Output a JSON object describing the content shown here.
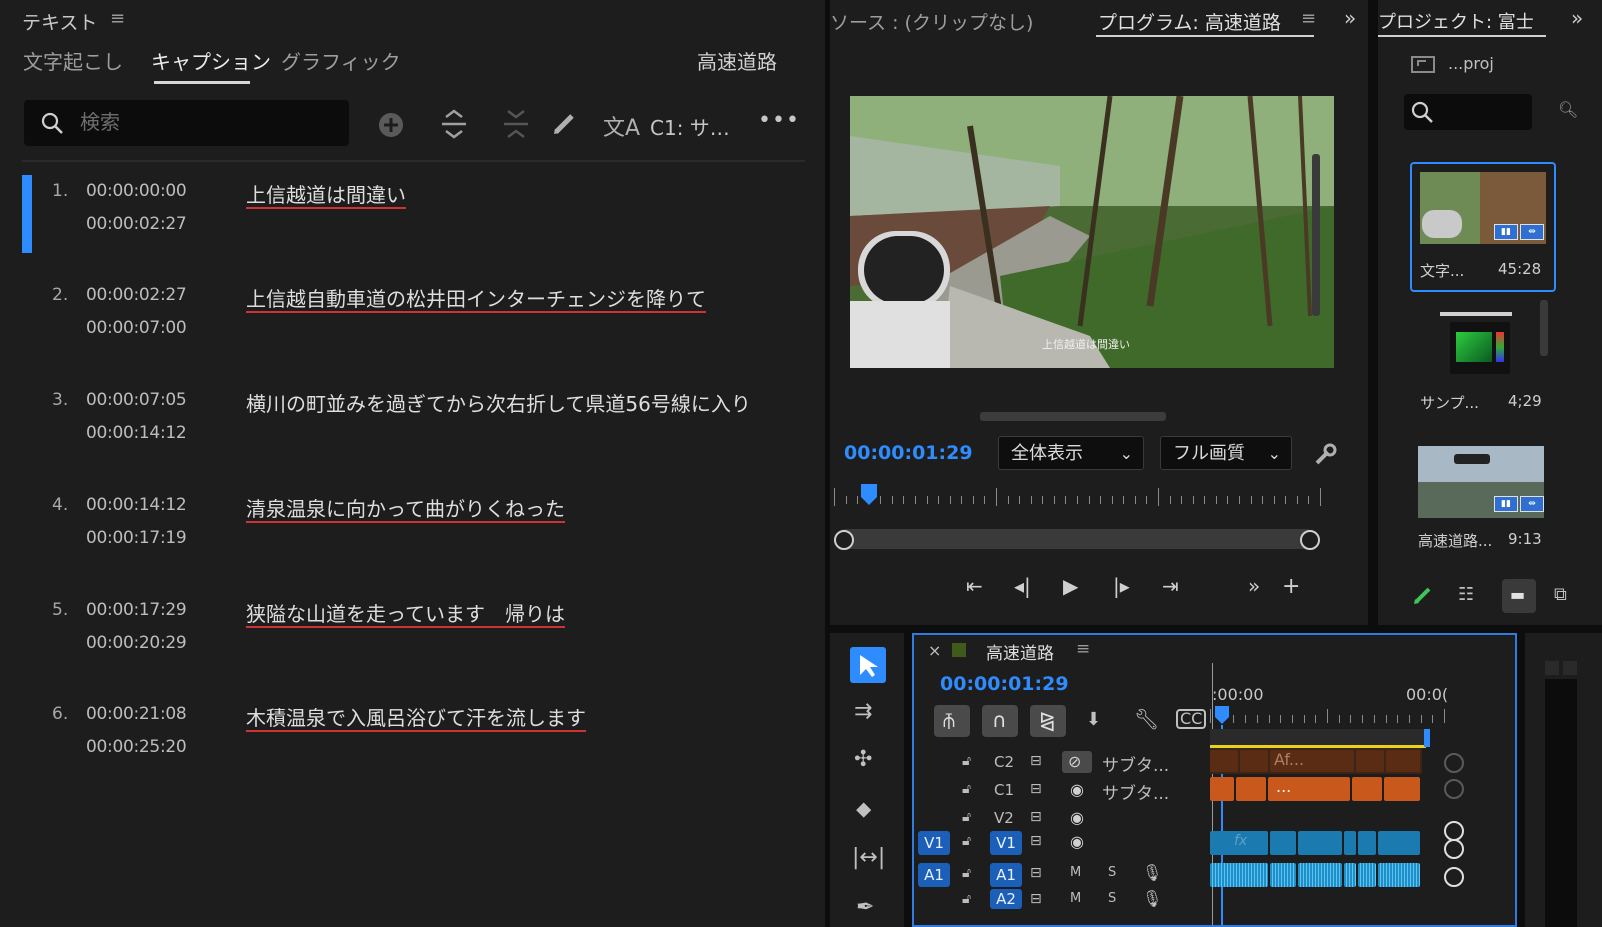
{
  "text_panel": {
    "title": "テキスト",
    "menu_icon": "hamburger-icon",
    "tabs": [
      {
        "label": "文字起こし",
        "active": false
      },
      {
        "label": "キャプション",
        "active": true
      },
      {
        "label": "グラフィック",
        "active": false
      }
    ],
    "sequence_name": "高速道路",
    "search_placeholder": "検索",
    "toolbar": {
      "icons": [
        "add-icon",
        "split-expand-icon",
        "merge-icon",
        "pencil-icon",
        "translate-icon",
        "more-icon"
      ],
      "track_label": "C1: サ…",
      "more_label": "•••"
    },
    "captions": [
      {
        "num": "1.",
        "start": "00:00:00:00",
        "end": "00:00:02:27",
        "text": "上信越道は間違い",
        "underlined": true
      },
      {
        "num": "2.",
        "start": "00:00:02:27",
        "end": "00:00:07:00",
        "text": "上信越自動車道の松井田インターチェンジを降りて",
        "underlined": true
      },
      {
        "num": "3.",
        "start": "00:00:07:05",
        "end": "00:00:14:12",
        "text": "横川の町並みを過ぎてから次右折して県道56号線に入り",
        "underlined": false
      },
      {
        "num": "4.",
        "start": "00:00:14:12",
        "end": "00:00:17:19",
        "text": "清泉温泉に向かって曲がりくねった",
        "underlined": true
      },
      {
        "num": "5.",
        "start": "00:00:17:29",
        "end": "00:00:20:29",
        "text": "狭隘な山道を走っています　帰りは",
        "underlined": true
      },
      {
        "num": "6.",
        "start": "00:00:21:08",
        "end": "00:00:25:20",
        "text": "木積温泉で入風呂浴びて汗を流します",
        "underlined": true
      }
    ]
  },
  "program_panel": {
    "source_label": "ソース : (クリップなし)",
    "program_label": "プログラム: 高速道路",
    "menu_icon": "hamburger-icon",
    "overflow_label": "»",
    "video_caption": "上信越道は間違い",
    "timecode": "00:00:01:29",
    "zoom_select": "全体表示",
    "quality_select": "フル画質",
    "playhead_fraction": 0.08,
    "transport_icons": [
      "mark-in-icon",
      "step-back-icon",
      "play-icon",
      "step-forward-icon",
      "mark-out-icon",
      "more-controls-icon",
      "add-button-icon"
    ]
  },
  "project_panel": {
    "title": "プロジェクト: 富士",
    "folder_label": "...proj",
    "items": [
      {
        "name": "文字...",
        "duration": "45:28",
        "selected": true
      },
      {
        "name": "サンプ...",
        "duration": "4;29",
        "selected": false
      },
      {
        "name": "高速道路...",
        "duration": "9:13",
        "selected": false
      }
    ]
  },
  "tools": [
    "selection-tool-icon",
    "track-select-icon",
    "ripple-edit-icon",
    "razor-icon",
    "slip-icon",
    "pen-icon"
  ],
  "timeline": {
    "close_label": "×",
    "sequence_name": "高速道路",
    "timecode": "00:00:01:29",
    "ruler_labels": [
      ":00:00",
      "00:0("
    ],
    "tracks": [
      {
        "id": "C2",
        "label": "C2",
        "name": "サブタ...",
        "clip_text": "Af..."
      },
      {
        "id": "C1",
        "label": "C1",
        "name": "サブタ...",
        "clip_text": "..."
      },
      {
        "id": "V2",
        "label": "V2"
      },
      {
        "id": "V1",
        "label": "V1",
        "src": "V1"
      },
      {
        "id": "A1",
        "label": "A1",
        "src": "A1",
        "m": "M",
        "s": "S"
      },
      {
        "id": "A2",
        "label": "A2",
        "m": "M",
        "s": "S"
      }
    ],
    "fx_label": "fx"
  },
  "colors": {
    "accent": "#2f8cff",
    "caption_clip": "#c8581b",
    "video_clip": "#1b7bb0",
    "audio_clip": "#1f8fc9",
    "work_area": "#e8d21b"
  }
}
